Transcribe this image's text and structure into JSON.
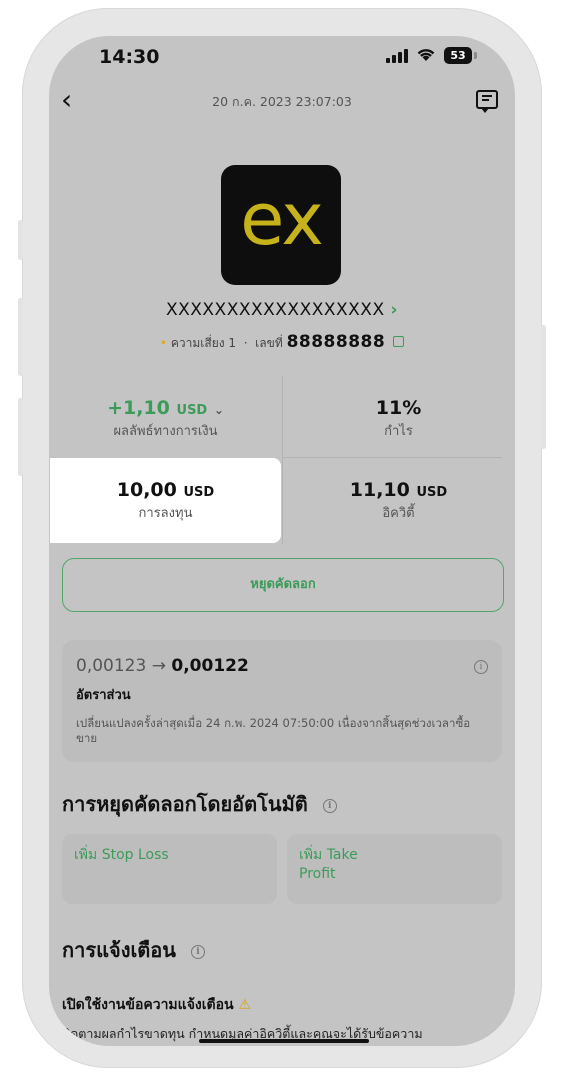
{
  "status_bar": {
    "time": "14:30",
    "battery": "53"
  },
  "header": {
    "datetime": "20 ก.ค. 2023 23:07:03"
  },
  "logo_text": "ex",
  "trader": {
    "name": "XXXXXXXXXXXXXXXXXX",
    "risk": "ความเสี่ยง 1",
    "separator": "·",
    "account_label": "เลขที่",
    "account_number": "88888888"
  },
  "stats": {
    "financial_result": {
      "value": "+1,10",
      "unit": "USD",
      "label": "ผลลัพธ์ทางการเงิน"
    },
    "profit": {
      "value": "11%",
      "label": "กำไร"
    },
    "investment": {
      "value": "10,00",
      "unit": "USD",
      "label": "การลงทุน"
    },
    "equity": {
      "value": "11,10",
      "unit": "USD",
      "label": "อิควิตี้"
    }
  },
  "stop_copy_button": "หยุดคัดลอก",
  "ratio": {
    "from": "0,00123",
    "arrow": "→",
    "to": "0,00122",
    "label": "อัตราส่วน",
    "note": "เปลี่ยนแปลงครั้งล่าสุดเมื่อ 24 ก.พ. 2024 07:50:00 เนื่องจากสิ้นสุดช่วงเวลาซื้อขาย"
  },
  "auto_stop": {
    "title": "การหยุดคัดลอกโดยอัตโนมัติ",
    "stop_loss": "เพิ่ม Stop Loss",
    "take_profit": "เพิ่ม Take Profit"
  },
  "alerts": {
    "title": "การแจ้งเตือน",
    "enable_title": "เปิดใช้งานข้อความแจ้งเตือน",
    "description": "ติดตามผลกำไรขาดทุน กำหนดมูลค่าอิควิตี้และคุณจะได้รับข้อความ"
  },
  "colors": {
    "accent_green": "#3d9b5a",
    "logo_yellow": "#c6b21b",
    "warning": "#d4a21a"
  }
}
